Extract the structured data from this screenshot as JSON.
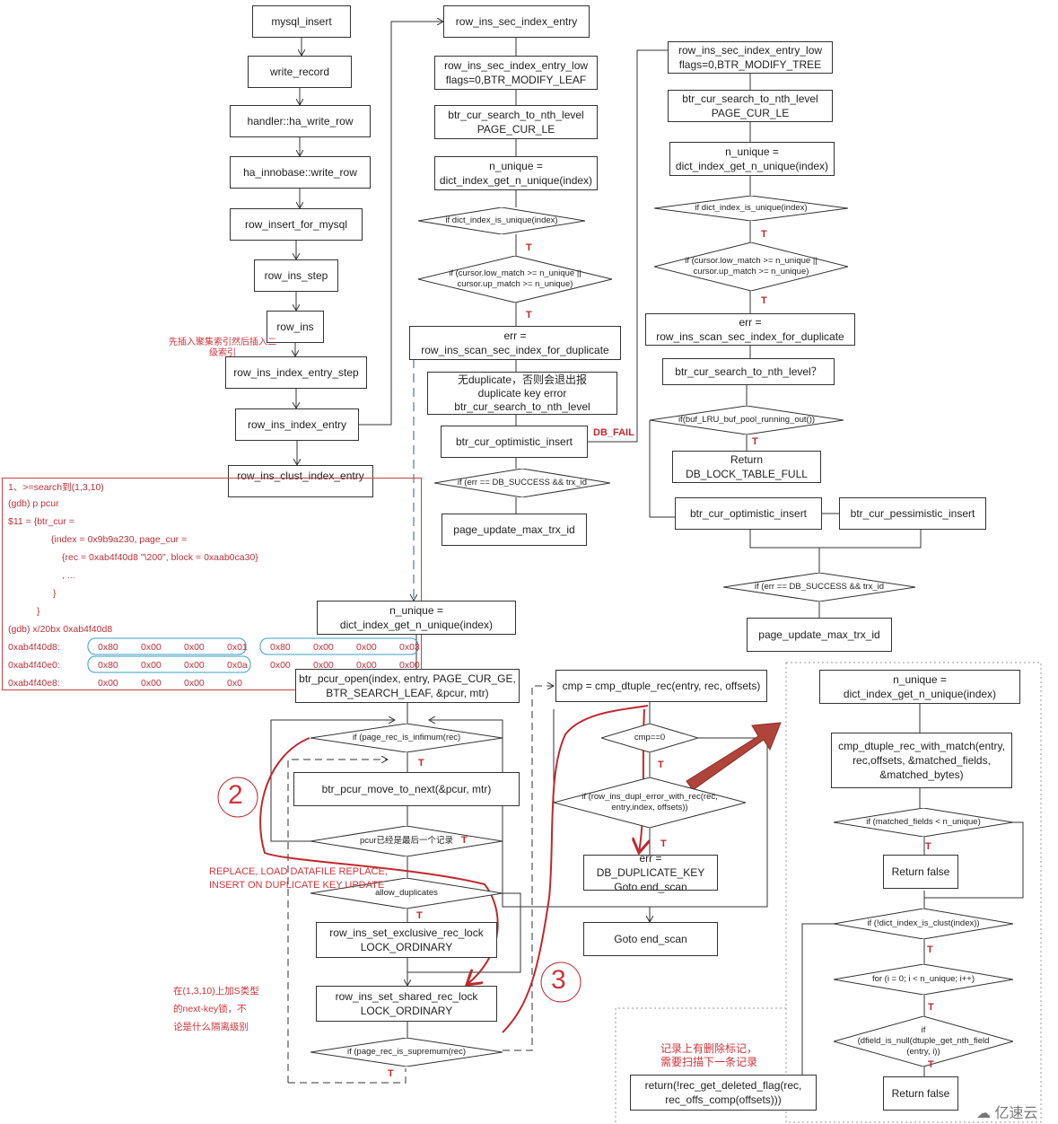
{
  "col1": [
    "mysql_insert",
    "write_record",
    "handler::ha_write_row",
    "ha_innobase::write_row",
    "row_insert_for_mysql",
    "row_ins_step",
    "row_ins",
    "row_ins_index_entry_step",
    "row_ins_index_entry",
    "row_ins_clust_index_entry"
  ],
  "col1_note": "先插入聚集索引然后插入二\n级索引",
  "col2": {
    "b1": "row_ins_sec_index_entry",
    "b2": "row_ins_sec_index_entry_low\nflags=0,BTR_MODIFY_LEAF",
    "b3": "btr_cur_search_to_nth_level\nPAGE_CUR_LE",
    "b4": "n_unique =\ndict_index_get_n_unique(index)",
    "d1": "if dict_index_is_unique(index)",
    "d2": "if (cursor.low_match >= n_unique ||\ncursor.up_match >= n_unique)",
    "b5": "err =\nrow_ins_scan_sec_index_for_duplicate",
    "b6": "无duplicate，否则会退出报\nduplicate key error\nbtr_cur_search_to_nth_level",
    "b7": "btr_cur_optimistic_insert",
    "fail": "DB_FAIL",
    "d3": "if (err == DB_SUCCESS && trx_id",
    "b8": "page_update_max_trx_id"
  },
  "col3": {
    "b1": "row_ins_sec_index_entry_low\nflags=0,BTR_MODIFY_TREE",
    "b2": "btr_cur_search_to_nth_level\nPAGE_CUR_LE",
    "b3": "n_unique =\ndict_index_get_n_unique(index)",
    "d1": "if dict_index_is_unique(index)",
    "d2": "if (cursor.low_match >= n_unique ||\ncursor.up_match >= n_unique)",
    "b4": "err =\nrow_ins_scan_sec_index_for_duplicate",
    "b5": "btr_cur_search_to_nth_level？",
    "d3": "if(buf_LRU_buf_pool_running_out())",
    "b6": "Return\nDB_LOCK_TABLE_FULL",
    "b7": "btr_cur_optimistic_insert",
    "b8": "btr_cur_pessimistic_insert",
    "d4": "if (err == DB_SUCCESS && trx_id",
    "b9": "page_update_max_trx_id"
  },
  "gdb": {
    "lines": [
      "1、>=search到(1,3,10)",
      "(gdb) p pcur",
      "$11 = {btr_cur =",
      "{index = 0x9b9a230, page_cur =",
      "{rec = 0xab4f40d8 \"\\200\", block = 0xaab0ca30}",
      ", ...",
      "}",
      "}",
      "(gdb) x/20bx 0xab4f40d8"
    ],
    "mem": [
      {
        "addr": "0xab4f40d8:",
        "bytes": [
          "0x80",
          "0x00",
          "0x00",
          "0x01",
          "0x80",
          "0x00",
          "0x00",
          "0x03"
        ]
      },
      {
        "addr": "0xab4f40e0:",
        "bytes": [
          "0x80",
          "0x00",
          "0x00",
          "0x0a",
          "0x00",
          "0x00",
          "0x00",
          "0x00"
        ]
      },
      {
        "addr": "0xab4f40e8:",
        "bytes": [
          "0x00",
          "0x00",
          "0x00",
          "0x0"
        ]
      }
    ]
  },
  "scan": {
    "b1": "n_unique =\ndict_index_get_n_unique(index)",
    "b2": "btr_pcur_open(index, entry, PAGE_CUR_GE,\nBTR_SEARCH_LEAF, &pcur, mtr)",
    "d1": "if (page_rec_is_infimum(rec)",
    "b3": "btr_pcur_move_to_next(&pcur, mtr)",
    "d2": "pcur已经是最后一个记录",
    "note1": "REPLACE, LOAD DATAFILE REPLACE,\nINSERT ON DUPLICATE KEY UPDATE",
    "d3": "allow_duplicates",
    "b4": "row_ins_set_exclusive_rec_lock\nLOCK_ORDINARY",
    "b5": "row_ins_set_shared_rec_lock\nLOCK_ORDINARY",
    "d4": "if (page_rec_is_supremum(rec)",
    "note2": "在(1,3,10)上加S类型\n的next-key锁，不\n论是什么隔离级别",
    "circle2": "2",
    "circle3": "3"
  },
  "cmp": {
    "b1": "cmp = cmp_dtuple_rec(entry, rec, offsets)",
    "d1": "cmp==0",
    "d2": "if (row_ins_dupl_error_with_rec(rec,\nentry,index, offsets))",
    "b2": "err = DB_DUPLICATE_KEY\nGoto end_scan",
    "b3": "Goto end_scan"
  },
  "dupl": {
    "b1": "n_unique =\ndict_index_get_n_unique(index)",
    "b2": "cmp_dtuple_rec_with_match(entry,\nrec,offsets, &matched_fields,\n&matched_bytes)",
    "d1": "if (matched_fields < n_unique)",
    "b3": "Return false",
    "d2": "if (!dict_index_is_clust(index))",
    "d3": "for (i = 0; i < n_unique; i++)",
    "d4": "if\n(dfield_is_null(dtuple_get_nth_field\n(entry, i))",
    "b4": "Return false",
    "note": "记录上有删除标记，\n需要扫描下一条记录",
    "b5": "return(!rec_get_deleted_flag(rec,\nrec_offs_comp(offsets)))"
  },
  "true_label": "T",
  "watermark": "亿速云",
  "colors": {
    "annotation": "#d0343a",
    "highlight": "#3a9fc0",
    "arrow": "#b0443a"
  }
}
